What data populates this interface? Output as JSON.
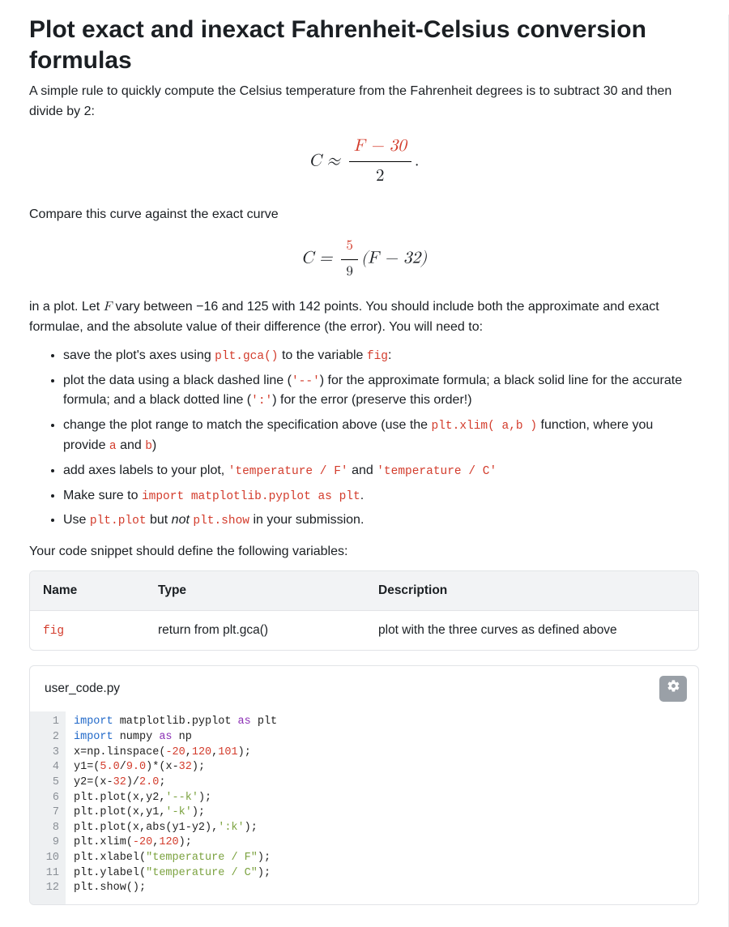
{
  "title": "Plot exact and inexact Fahrenheit-Celsius conversion formulas",
  "intro": "A simple rule to quickly compute the Celsius temperature from the Fahrenheit degrees is to subtract 30 and then divide by 2:",
  "formula1": {
    "lhs": "C ≈",
    "num": "F − 30",
    "den": "2",
    "tail": "."
  },
  "compare": "Compare this curve against the exact curve",
  "formula2": {
    "lhs": "C =",
    "fracnum": "5",
    "fracden": "9",
    "rhs": "(F − 32)"
  },
  "plot_para_parts": {
    "p1": "in a plot. Let ",
    "F": "F",
    "p2": " vary between ",
    "lo": "−16",
    "p3": " and ",
    "hi": "125",
    "p4": " with 142 points. You should include both the approximate and exact formulae, and the absolute value of their difference (the error). You will need to:"
  },
  "bullets": {
    "b1_a": "save the plot's axes using ",
    "b1_code1": "plt.gca()",
    "b1_b": " to the variable ",
    "b1_code2": "fig",
    "b1_c": ":",
    "b2_a": "plot the data using a black dashed line (",
    "b2_code1": "'--'",
    "b2_b": ") for the approximate formula; a black solid line for the accurate formula; and a black dotted line (",
    "b2_code2": "':'",
    "b2_c": ") for the error (preserve this order!)",
    "b3_a": "change the plot range to match the specification above (use the ",
    "b3_code1": "plt.xlim( a,b )",
    "b3_b": " function, where you provide ",
    "b3_code2": "a",
    "b3_c": " and ",
    "b3_code3": "b",
    "b3_d": ")",
    "b4_a": "add axes labels to your plot, ",
    "b4_code1": "'temperature / F'",
    "b4_b": " and ",
    "b4_code2": "'temperature / C'",
    "b5_a": "Make sure to ",
    "b5_code1": "import matplotlib.pyplot as plt",
    "b5_b": ".",
    "b6_a": "Use ",
    "b6_code1": "plt.plot",
    "b6_b": " but ",
    "b6_em": "not",
    "b6_c": " ",
    "b6_code2": "plt.show",
    "b6_d": " in your submission."
  },
  "vars_intro": "Your code snippet should define the following variables:",
  "table": {
    "headers": {
      "name": "Name",
      "type": "Type",
      "desc": "Description"
    },
    "row": {
      "name": "fig",
      "type": "return from plt.gca()",
      "desc": "plot with the three curves as defined above"
    }
  },
  "filename": "user_code.py",
  "code_lines": [
    {
      "n": 1,
      "tokens": [
        [
          "kw",
          "import"
        ],
        [
          "pn",
          " matplotlib"
        ],
        [
          "pn",
          ".pyplot "
        ],
        [
          "kw2",
          "as"
        ],
        [
          "pn",
          " plt"
        ]
      ]
    },
    {
      "n": 2,
      "tokens": [
        [
          "kw",
          "import"
        ],
        [
          "pn",
          " numpy "
        ],
        [
          "kw2",
          "as"
        ],
        [
          "pn",
          " np"
        ]
      ]
    },
    {
      "n": 3,
      "tokens": [
        [
          "pn",
          "x"
        ],
        [
          "pn",
          "="
        ],
        [
          "pn",
          "np.linspace("
        ],
        [
          "num",
          "-20"
        ],
        [
          "pn",
          ","
        ],
        [
          "num",
          "120"
        ],
        [
          "pn",
          ","
        ],
        [
          "num",
          "101"
        ],
        [
          "pn",
          ");"
        ]
      ]
    },
    {
      "n": 4,
      "tokens": [
        [
          "pn",
          "y1"
        ],
        [
          "pn",
          "=("
        ],
        [
          "num",
          "5.0"
        ],
        [
          "pn",
          "/"
        ],
        [
          "num",
          "9.0"
        ],
        [
          "pn",
          ")"
        ],
        [
          "pn",
          "*"
        ],
        [
          "pn",
          "(x"
        ],
        [
          "pn",
          "-"
        ],
        [
          "num",
          "32"
        ],
        [
          "pn",
          ");"
        ]
      ]
    },
    {
      "n": 5,
      "tokens": [
        [
          "pn",
          "y2"
        ],
        [
          "pn",
          "=(x"
        ],
        [
          "pn",
          "-"
        ],
        [
          "num",
          "32"
        ],
        [
          "pn",
          ")/"
        ],
        [
          "num",
          "2.0"
        ],
        [
          "pn",
          ";"
        ]
      ]
    },
    {
      "n": 6,
      "tokens": [
        [
          "pn",
          "plt.plot(x,y2,"
        ],
        [
          "str",
          "'--k'"
        ],
        [
          "pn",
          ");"
        ]
      ]
    },
    {
      "n": 7,
      "tokens": [
        [
          "pn",
          "plt.plot(x,y1,"
        ],
        [
          "str",
          "'-k'"
        ],
        [
          "pn",
          ");"
        ]
      ]
    },
    {
      "n": 8,
      "tokens": [
        [
          "pn",
          "plt.plot(x,abs(y1-y2),"
        ],
        [
          "str",
          "':k'"
        ],
        [
          "pn",
          ");"
        ]
      ]
    },
    {
      "n": 9,
      "tokens": [
        [
          "pn",
          "plt.xlim("
        ],
        [
          "num",
          "-20"
        ],
        [
          "pn",
          ","
        ],
        [
          "num",
          "120"
        ],
        [
          "pn",
          ");"
        ]
      ]
    },
    {
      "n": 10,
      "tokens": [
        [
          "pn",
          "plt.xlabel("
        ],
        [
          "str",
          "\"temperature / F\""
        ],
        [
          "pn",
          ");"
        ]
      ]
    },
    {
      "n": 11,
      "tokens": [
        [
          "pn",
          "plt.ylabel("
        ],
        [
          "str",
          "\"temperature / C\""
        ],
        [
          "pn",
          ");"
        ]
      ]
    },
    {
      "n": 12,
      "tokens": [
        [
          "pn",
          "plt.show();"
        ]
      ]
    }
  ]
}
